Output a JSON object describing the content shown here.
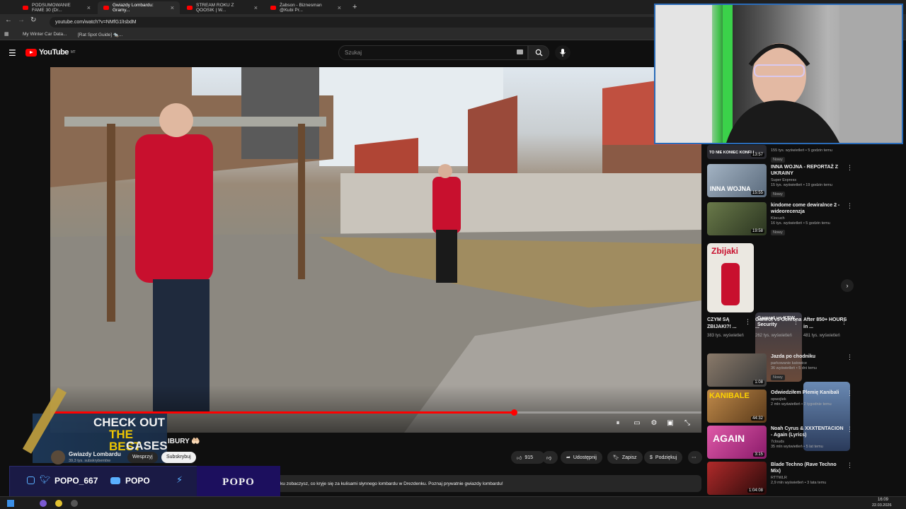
{
  "browser": {
    "tabs": [
      {
        "label": "PODSUMOWANIE FAME 30 (Dr..."
      },
      {
        "label": "Gwiazdy Lombardu: Gramy..."
      },
      {
        "label": "STREAM ROKU Z QOOSIK | W..."
      },
      {
        "label": "Żabson - Biznesman @Kubi Pr..."
      }
    ],
    "url": "youtube.com/watch?v=NMfG1lIsbdM",
    "bookmarks": [
      "My Winter Car Data...",
      "[Rat Spot Guide] 🐀..."
    ]
  },
  "header": {
    "logo_text": "YouTube",
    "logo_region": "MT",
    "search_placeholder": "Szukaj"
  },
  "video": {
    "progress_fraction": 0.712,
    "title_fragment": "IBURY 🤲🏻",
    "overlay_text_1": "CHECK OUT",
    "overlay_text_2": "THE BEST",
    "overlay_text_3": "CASES"
  },
  "channel": {
    "name": "Gwiazdy Lombardu",
    "subscribers": "39,3 tys. subskrybentów",
    "support_label": "Wesprzyj",
    "subscribe_label": "Subskrybuj"
  },
  "actions": {
    "likes": "915",
    "share": "Udostępnij",
    "save": "Zapisz",
    "thanks": "Podziękuj"
  },
  "description": "ku zobaczysz, co kryje się za kulisami słynnego lombardu w Drezdenku. Poznaj prywatnie gwiazdy lombardu!",
  "sidebar": {
    "top_partial": {
      "thumb_text": "TO NIE KONIEC KONFLI",
      "duration": "13:57",
      "stats": "155 tys. wyświetleń • 5 godzin temu",
      "badge": "Nowy"
    },
    "items": [
      {
        "title": "INNA WOJNA - REPORTAŻ Z UKRAINY",
        "channel": "Super Express",
        "stats": "15 tys. wyświetleń • 19 godzin temu",
        "badge": "Nowy",
        "duration": "15:55",
        "thumb_text": "INNA WOJNA",
        "thumb_color": "#6b7b8c"
      },
      {
        "title": "kindome come dewiralnce 2 - wideorecenzja",
        "channel": "Klocuch",
        "stats": "16 tys. wyświetleń • 5 godzin temu",
        "badge": "Nowy",
        "duration": "19:58",
        "thumb_text": "",
        "thumb_color": "#4d5a3a"
      }
    ],
    "shorts": [
      {
        "title": "CZYM SĄ ZBIJAKI?! ...",
        "stats": "383 tys. wyświetleń",
        "thumb_text": "Zbijaki",
        "color": "#e9e6df"
      },
      {
        "title": "Gamrot vs Ochrona ...",
        "stats": "262 tys. wyświetleń",
        "thumb_text": "Gamrot vs KSW Security",
        "color": "#4a3a30"
      },
      {
        "title": "After 850+ HOURS in ...",
        "stats": "481 tys. wyświetleń",
        "thumb_text": "",
        "color": "#3a4a6a"
      }
    ],
    "items2": [
      {
        "title": "Jazda po chodniku",
        "channel": "parkowanie katowice",
        "stats": "36 wyświetleń • 5 dni temu",
        "badge": "Nowy",
        "duration": "1:08",
        "thumb_text": "",
        "thumb_color": "#6a5a50"
      },
      {
        "title": "Odwiedziłem Plemię Kanibali",
        "channel": "opwojtek",
        "stats": "2 mln wyświetleń • 2 tygodnie temu",
        "badge": "",
        "duration": "44:32",
        "thumb_text": "KANIBALE",
        "thumb_color": "#9a6a3a"
      },
      {
        "title": "Noah Cyrus & XXXTENTACION - Again (Lyrics)",
        "channel": "7clouds",
        "stats": "35 mln wyświetleń • 5 lat temu",
        "badge": "",
        "duration": "3:15",
        "thumb_text": "AGAIN",
        "thumb_color": "#c23a8a"
      },
      {
        "title": "Blade Techno (Rave Techno Mix)",
        "channel": "RTTWLR",
        "stats": "2,9 mln wyświetleń • 3 lata temu",
        "badge": "",
        "duration": "1:04:08",
        "thumb_text": "",
        "thumb_color": "#8a1a1a"
      }
    ]
  },
  "stream_overlay": {
    "handle": "POPO_667",
    "yt_name": "POPO",
    "brand": "POPO"
  },
  "taskbar": {
    "time": "16:09",
    "date": "22.03.2026"
  }
}
